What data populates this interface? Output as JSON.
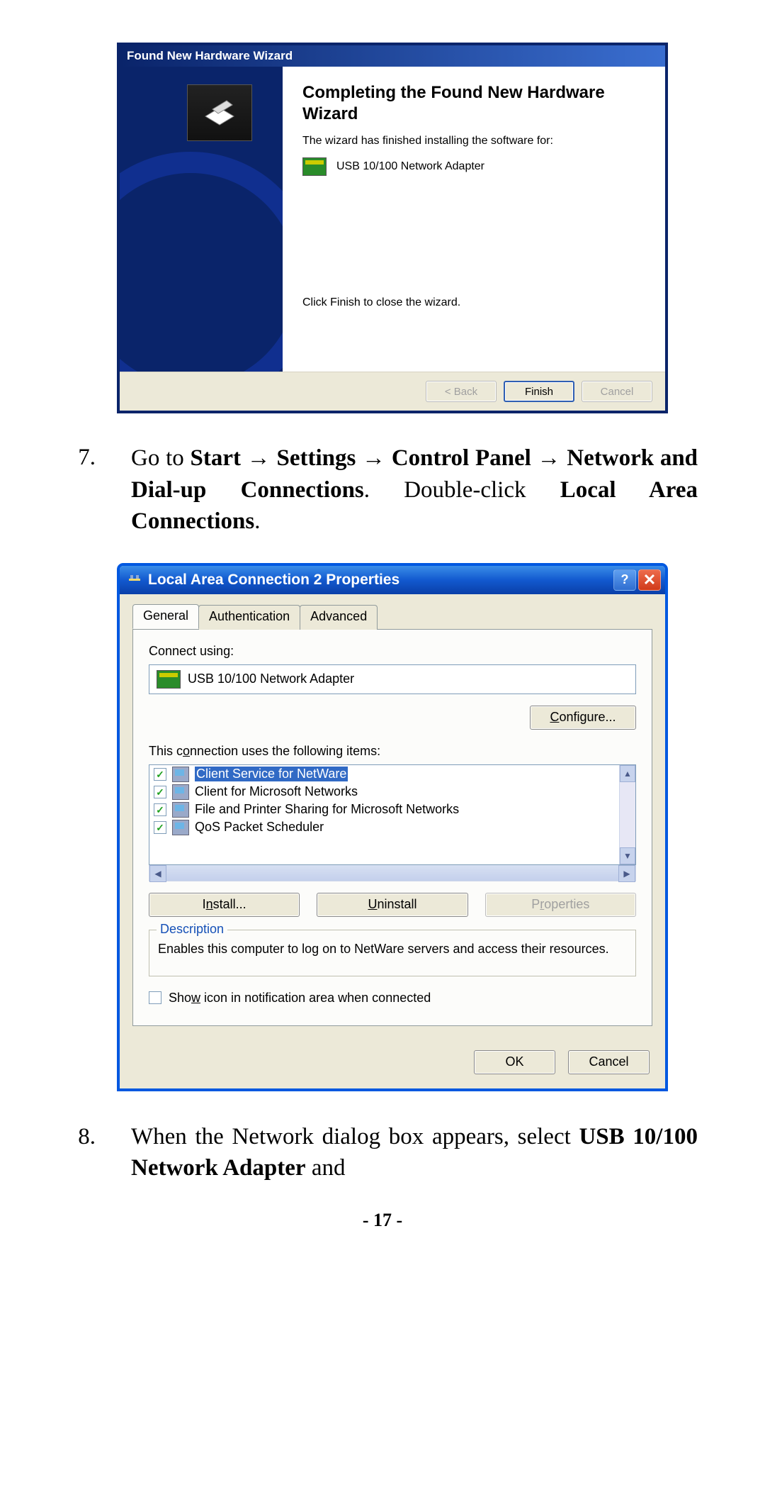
{
  "wizard": {
    "title": "Found New Hardware Wizard",
    "heading": "Completing the Found New Hardware Wizard",
    "subtext": "The wizard has finished installing the software for:",
    "device": "USB 10/100 Network Adapter",
    "closing": "Click Finish to close the wizard.",
    "back": "< Back",
    "finish": "Finish",
    "cancel": "Cancel"
  },
  "step7": {
    "num": "7.",
    "pre": "Go to ",
    "b1": "Start",
    "b2": "Settings",
    "b3": "Control Panel",
    "b4": "Network and Dial-up Connections",
    "mid": ". Double-click ",
    "b5": "Local Area Connections",
    "end": "."
  },
  "props": {
    "title": "Local Area Connection 2 Properties",
    "tabs": {
      "general": "General",
      "auth": "Authentication",
      "adv": "Advanced"
    },
    "connect_label": "Connect using:",
    "adapter": "USB 10/100 Network Adapter",
    "configure": "Configure...",
    "items_label": "This connection uses the following items:",
    "items": [
      "Client Service for NetWare",
      "Client for Microsoft Networks",
      "File and Printer Sharing for Microsoft Networks",
      "QoS Packet Scheduler"
    ],
    "install": "Install...",
    "uninstall": "Uninstall",
    "properties": "Properties",
    "desc_label": "Description",
    "desc_text": "Enables this computer to log on to NetWare servers and access their resources.",
    "show_icon": "Show icon in notification area when connected",
    "ok": "OK",
    "cancel": "Cancel"
  },
  "step8": {
    "num": "8.",
    "pre": "When the Network dialog box appears, select ",
    "b1": "USB 10/100 Network Adapter",
    "post": " and"
  },
  "page_num": "- 17 -"
}
